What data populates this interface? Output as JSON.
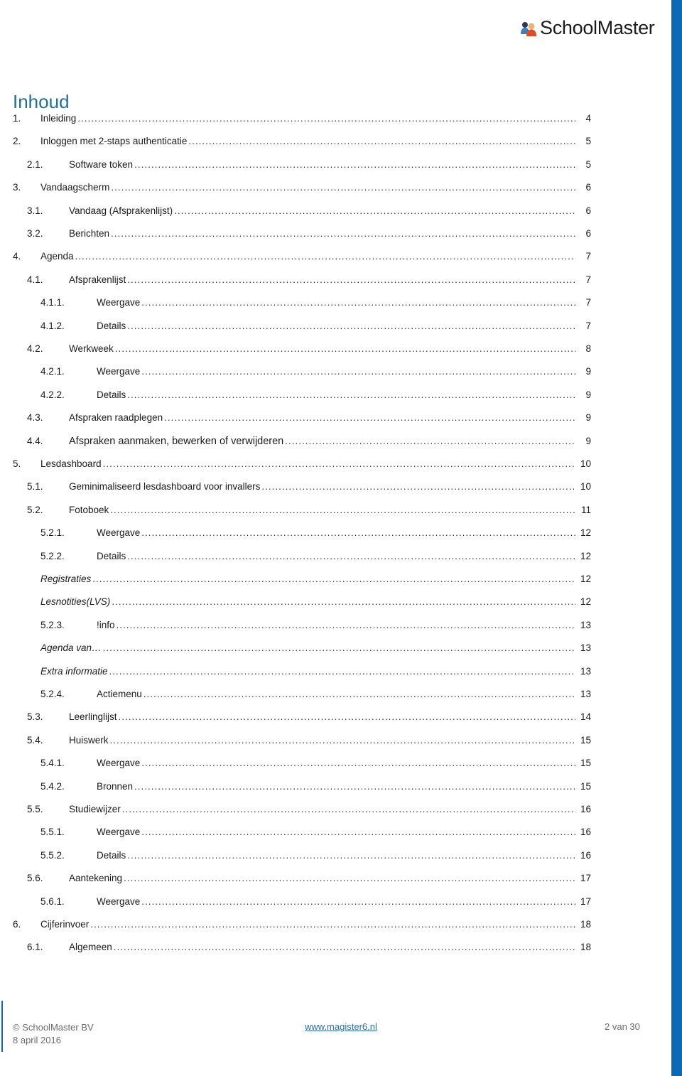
{
  "header": {
    "brand": "SchoolMaster",
    "logo_icon": "people-icon",
    "colors": {
      "accent": "#0a6ab5",
      "title": "#1f6f9c",
      "link": "#2a6fa0"
    }
  },
  "toc": {
    "title": "Inhoud",
    "entries": [
      {
        "num": "1.",
        "label": "Inleiding",
        "page": "4",
        "level": 1
      },
      {
        "num": "2.",
        "label": "Inloggen met 2-staps authenticatie",
        "page": "5",
        "level": 1
      },
      {
        "num": "2.1.",
        "label": "Software token",
        "page": "5",
        "level": 2
      },
      {
        "num": "3.",
        "label": "Vandaagscherm",
        "page": "6",
        "level": 1
      },
      {
        "num": "3.1.",
        "label": "Vandaag (Afsprakenlijst)",
        "page": "6",
        "level": 2
      },
      {
        "num": "3.2.",
        "label": "Berichten",
        "page": "6",
        "level": 2
      },
      {
        "num": "4.",
        "label": "Agenda",
        "page": "7",
        "level": 1
      },
      {
        "num": "4.1.",
        "label": "Afsprakenlijst",
        "page": "7",
        "level": 2
      },
      {
        "num": "4.1.1.",
        "label": "Weergave",
        "page": "7",
        "level": 3
      },
      {
        "num": "4.1.2.",
        "label": "Details",
        "page": "7",
        "level": 3
      },
      {
        "num": "4.2.",
        "label": "Werkweek",
        "page": "8",
        "level": 2
      },
      {
        "num": "4.2.1.",
        "label": "Weergave",
        "page": "9",
        "level": 3
      },
      {
        "num": "4.2.2.",
        "label": "Details",
        "page": "9",
        "level": 3
      },
      {
        "num": "4.3.",
        "label": "Afspraken raadplegen",
        "page": "9",
        "level": 2
      },
      {
        "num": "4.4.",
        "label": "Afspraken aanmaken, bewerken of verwijderen",
        "page": "9",
        "level": 2,
        "larger": true
      },
      {
        "num": "5.",
        "label": "Lesdashboard",
        "page": "10",
        "level": 1
      },
      {
        "num": "5.1.",
        "label": "Geminimaliseerd lesdashboard voor invallers",
        "page": "10",
        "level": 2
      },
      {
        "num": "5.2.",
        "label": "Fotoboek",
        "page": "11",
        "level": 2
      },
      {
        "num": "5.2.1.",
        "label": "Weergave",
        "page": "12",
        "level": 3
      },
      {
        "num": "5.2.2.",
        "label": "Details",
        "page": "12",
        "level": 3
      },
      {
        "num": "",
        "label": "Registraties",
        "page": "12",
        "level": 3,
        "italic": true
      },
      {
        "num": "",
        "label": "Lesnotities(LVS)",
        "page": "12",
        "level": 3,
        "italic": true
      },
      {
        "num": "5.2.3.",
        "label": "!info",
        "page": "13",
        "level": 3
      },
      {
        "num": "",
        "label": "Agenda van…",
        "page": "13",
        "level": 3,
        "italic": true
      },
      {
        "num": "",
        "label": "Extra informatie",
        "page": "13",
        "level": 3,
        "italic": true
      },
      {
        "num": "5.2.4.",
        "label": "Actiemenu",
        "page": "13",
        "level": 3
      },
      {
        "num": "5.3.",
        "label": "Leerlinglijst",
        "page": "14",
        "level": 2
      },
      {
        "num": "5.4.",
        "label": "Huiswerk",
        "page": "15",
        "level": 2
      },
      {
        "num": "5.4.1.",
        "label": "Weergave",
        "page": "15",
        "level": 3
      },
      {
        "num": "5.4.2.",
        "label": "Bronnen",
        "page": "15",
        "level": 3
      },
      {
        "num": "5.5.",
        "label": "Studiewijzer",
        "page": "16",
        "level": 2
      },
      {
        "num": "5.5.1.",
        "label": "Weergave",
        "page": "16",
        "level": 3
      },
      {
        "num": "5.5.2.",
        "label": "Details",
        "page": "16",
        "level": 3
      },
      {
        "num": "5.6.",
        "label": "Aantekening",
        "page": "17",
        "level": 2
      },
      {
        "num": "5.6.1.",
        "label": "Weergave",
        "page": "17",
        "level": 3
      },
      {
        "num": "6.",
        "label": "Cijferinvoer",
        "page": "18",
        "level": 1
      },
      {
        "num": "6.1.",
        "label": "Algemeen",
        "page": "18",
        "level": 2
      }
    ]
  },
  "footer": {
    "copyright": "© SchoolMaster BV",
    "date": "8 april 2016",
    "website": "www.magister6.nl",
    "page_indicator": "2 van 30"
  }
}
